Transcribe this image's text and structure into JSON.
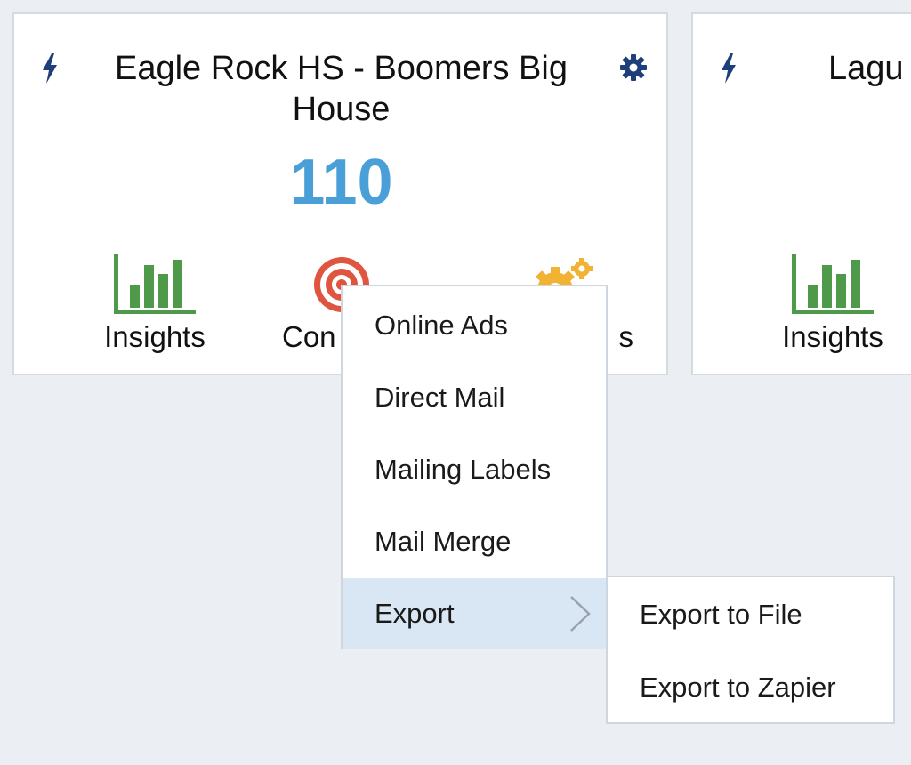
{
  "cards": [
    {
      "title": "Eagle Rock HS - Boomers Big House",
      "count": "110",
      "actions": [
        {
          "label": "Insights",
          "icon": "bar-chart-icon"
        },
        {
          "label": "Con",
          "icon": "target-icon"
        },
        {
          "label": "s",
          "icon": "gears-icon"
        }
      ]
    },
    {
      "title": "Lagu",
      "actions": [
        {
          "label": "Insights",
          "icon": "bar-chart-icon"
        }
      ]
    }
  ],
  "menu": {
    "items": [
      {
        "label": "Online Ads"
      },
      {
        "label": "Direct Mail"
      },
      {
        "label": "Mailing Labels"
      },
      {
        "label": "Mail Merge"
      },
      {
        "label": "Export",
        "active": true,
        "has_submenu": true
      }
    ]
  },
  "submenu": {
    "items": [
      {
        "label": "Export to File"
      },
      {
        "label": "Export to Zapier"
      }
    ]
  },
  "colors": {
    "count": "#4a9fd8",
    "bolt": "#1f3f7a",
    "chart": "#4e9a4a",
    "target": "#e0553f",
    "gears": "#f2b233",
    "menu_active": "#d9e7f4"
  }
}
